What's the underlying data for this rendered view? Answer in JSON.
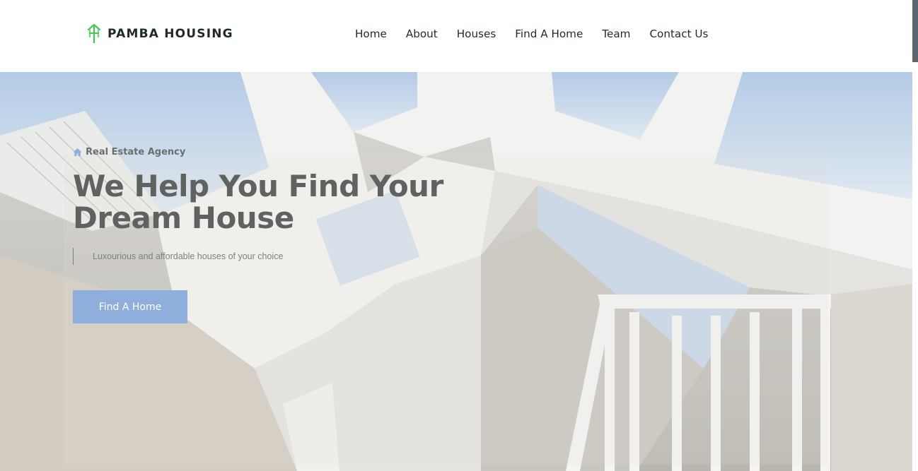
{
  "brand": {
    "name": "PAMBA HOUSING",
    "logo_icon": "pitchfork-house-icon",
    "accent": "#4cc15a"
  },
  "nav": {
    "items": [
      {
        "label": "Home"
      },
      {
        "label": "About"
      },
      {
        "label": "Houses"
      },
      {
        "label": "Find A Home"
      },
      {
        "label": "Team"
      },
      {
        "label": "Contact Us"
      }
    ]
  },
  "hero": {
    "tag_icon": "home-icon",
    "tag": "Real Estate Agency",
    "headline_line1": "We Help You Find Your",
    "headline_line2": "Dream House",
    "subtitle": "Luxourious and affordable houses of your choice",
    "cta_label": "Find A Home",
    "cta_color": "#8eaedb",
    "background": "skylight-staircase-photo"
  }
}
